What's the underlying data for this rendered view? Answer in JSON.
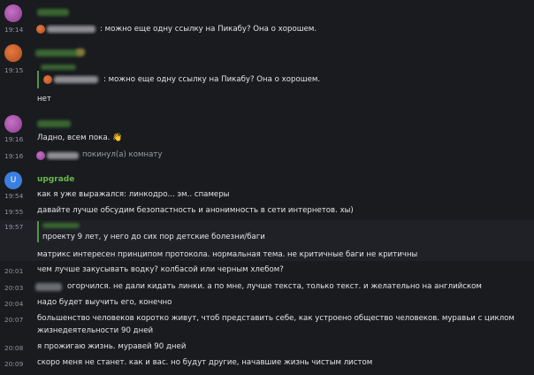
{
  "messages": [
    {
      "time": "19:14",
      "text": ": можно еще одну ссылку на Пикабу? Она о хорошем."
    },
    {
      "time": "19:15",
      "quote": ": можно еще одну ссылку на Пикабу? Она о хорошем.",
      "text": "нет"
    },
    {
      "time": "19:16",
      "text": "Ладно, всем пока.",
      "emoji": "👋"
    },
    {
      "time": "19:16",
      "text": "покинул(а) комнату"
    }
  ],
  "upgrade": {
    "avatar_letter": "U",
    "username": "upgrade",
    "lines": [
      {
        "time": "19:54",
        "text": "как я уже выражался: линкодро... эм.. спамеры"
      },
      {
        "time": "19:55",
        "text": "давайте лучше обсудим безопастность и анонимность в сети интернетов. хы)"
      },
      {
        "time": "19:57",
        "quote": "проекту 9 лет, у него до сих пор детские болезни/баги",
        "text": "матрикс интересен принципом протокола. нормальная тема. не критичные баги не критичны"
      },
      {
        "time": "20:01",
        "text": "чем лучше закусывать водку? колбасой или черным хлебом?"
      },
      {
        "time": "20:03",
        "text": "огорчился. не дали кидать линки. а по мне, лучше текста, только текст. и желательно на английском"
      },
      {
        "time": "20:04",
        "text": "надо будет выучить его, конечно"
      },
      {
        "time": "20:07",
        "text": "большенство человеков коротко живут, чтоб представить себе, как устроено общество человеков. муравьи с циклом"
      },
      {
        "time": "",
        "text": "жизнедеятельности 90 дней"
      },
      {
        "time": "20:08",
        "text": "я прожигаю жизнь. муравей 90 дней"
      },
      {
        "time": "20:09",
        "text": "скоро меня не станет. как и вас. но будут другие, начавшие жизнь чистым листом"
      }
    ]
  },
  "colors": {
    "background": "#191b1f",
    "username_green": "#68b84a",
    "quote_bar": "#4c9a3e",
    "avatar_blue": "#3b7fe0"
  }
}
